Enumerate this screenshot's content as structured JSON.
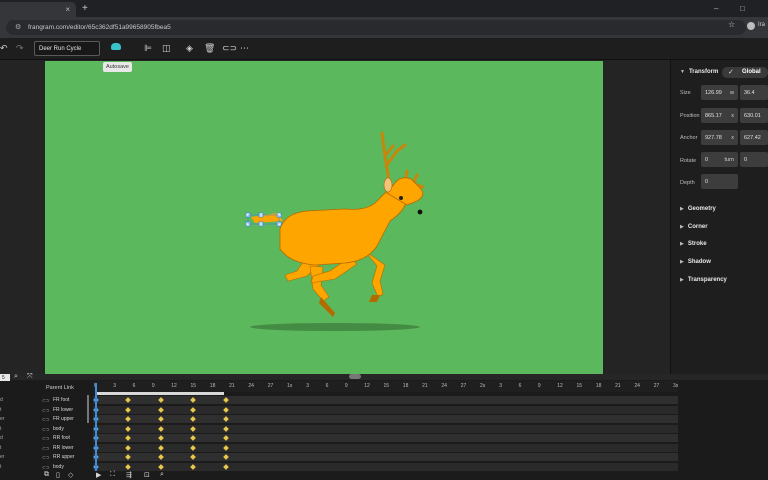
{
  "browser": {
    "url": "frangram.com/editor/65c362df51a99658905fbea5",
    "tab_close": "×",
    "new_tab": "+",
    "window_minimize": "–",
    "window_maximize": "□",
    "profile_label": "Ira"
  },
  "toolbar": {
    "document_name": "Deer Run Cycle",
    "autosave_tooltip": "Autosave"
  },
  "properties": {
    "transform": {
      "title": "Transform",
      "global_label": "Global",
      "size_label": "Size",
      "size_w": "126.99",
      "size_w_unit": "w",
      "size_h": "36.4",
      "position_label": "Position",
      "position_x": "865.17",
      "position_x_unit": "x",
      "position_y": "630.01",
      "anchor_label": "Anchor",
      "anchor_x": "927.78",
      "anchor_x_unit": "x",
      "anchor_y": "627.42",
      "rotate_label": "Rotate",
      "rotate_value": "0",
      "rotate_unit": "turn",
      "rotate_value2": "0",
      "depth_label": "Depth",
      "depth_value": "0"
    },
    "sections": [
      "Geometry",
      "Corner",
      "Stroke",
      "Shadow",
      "Transparency"
    ]
  },
  "timeline": {
    "zoom_value": "5",
    "parent_link_label": "Parent Link",
    "ruler_labels": [
      "0",
      "3",
      "6",
      "9",
      "12",
      "15",
      "18",
      "21",
      "24",
      "27",
      "1s",
      "3",
      "6",
      "9",
      "12",
      "15",
      "18",
      "21",
      "24",
      "27",
      "2s",
      "3",
      "6",
      "9",
      "12",
      "15",
      "18",
      "21",
      "24",
      "27",
      "3s"
    ],
    "layers": [
      {
        "edge": "d",
        "name": "FR foot"
      },
      {
        "edge": "t",
        "name": "FR lower"
      },
      {
        "edge": "er",
        "name": "FR upper"
      },
      {
        "edge": "t",
        "name": "body"
      },
      {
        "edge": "d",
        "name": "RR foot"
      },
      {
        "edge": "t",
        "name": "RR lower"
      },
      {
        "edge": "er",
        "name": "RR upper"
      },
      {
        "edge": "t",
        "name": "body"
      }
    ]
  },
  "colors": {
    "stage_bg": "#5cb85c",
    "deer_body": "#ffa500",
    "deer_outline": "#b36b00",
    "antler": "#c8860a",
    "selection": "#3d8bd9",
    "keyframe": "#e7c84a",
    "accent_autosave": "#39c2c9"
  },
  "icons": {
    "undo": "undo-icon",
    "redo": "redo-icon",
    "autosave": "cloud-icon",
    "align": "align-icon",
    "split": "split-panel-icon",
    "layers": "layers-icon",
    "delete": "trash-icon",
    "link": "link-icon",
    "more": "more-icon"
  }
}
